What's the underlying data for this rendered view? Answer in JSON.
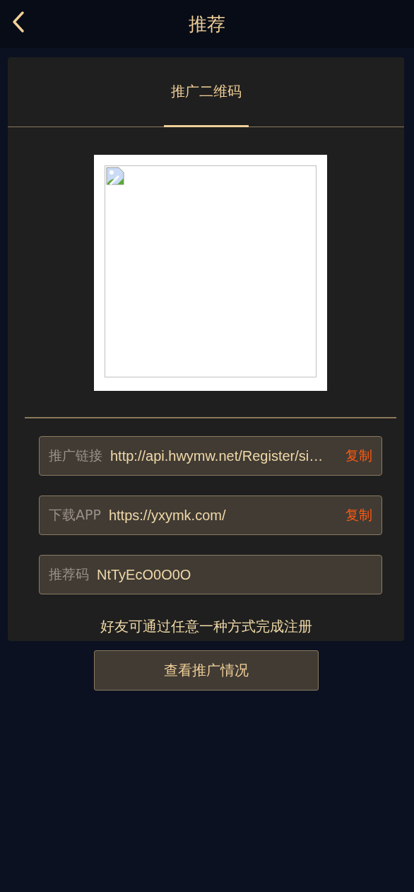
{
  "header": {
    "title": "推荐"
  },
  "tabs": [
    {
      "label": "推广二维码",
      "selected": true
    }
  ],
  "qr": {
    "kind": "broken-image"
  },
  "rows": [
    {
      "label": "推广链接",
      "value": "http://api.hwymw.net/Register/si…",
      "copy": "复制"
    },
    {
      "label": "下载APP",
      "value": "https://yxymk.com/",
      "copy": "复制"
    },
    {
      "label": "推荐码",
      "value": "NtTyEcO0O0O"
    }
  ],
  "note": "好友可通过任意一种方式完成注册",
  "button": "查看推广情况"
}
